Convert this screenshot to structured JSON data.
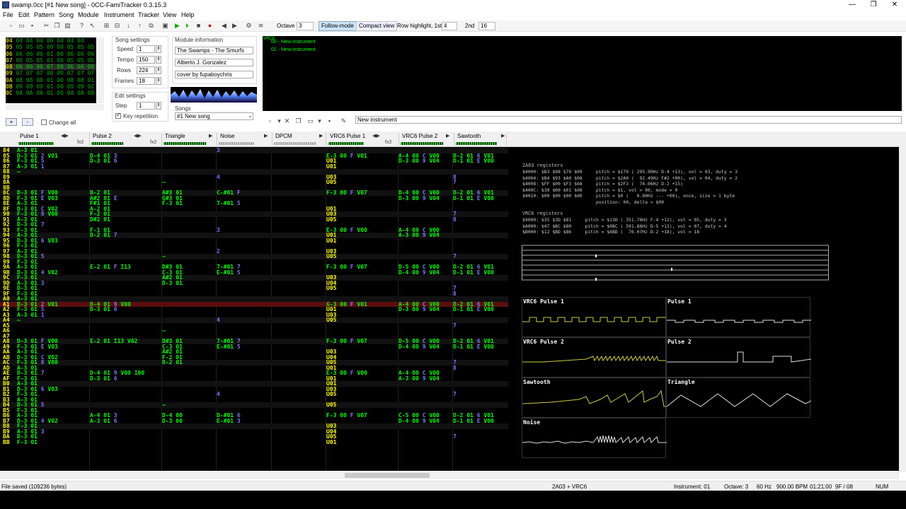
{
  "window": {
    "title": "swamp.0cc [#1 New song] - 0CC-FamiTracker 0.3.15.3",
    "min": "—",
    "max": "❐",
    "close": "✕"
  },
  "menu": [
    "File",
    "Edit",
    "Pattern",
    "Song",
    "Module",
    "Instrument",
    "Tracker",
    "View",
    "Help"
  ],
  "toolbar": {
    "octave_label": "Octave",
    "octave_value": "3",
    "follow_mode": "Follow-mode",
    "compact_view": "Compact view",
    "row_highlight_label": "Row highlight, 1st",
    "row_highlight_1st": "4",
    "second_label": "2nd",
    "row_highlight_2nd": "16"
  },
  "frames": {
    "rows": [
      {
        "n": "04",
        "cells": "04 04 04 00 04 04 04"
      },
      {
        "n": "05",
        "cells": "05 05 05 00 00 05 05 05"
      },
      {
        "n": "06",
        "cells": "06 06 06 01 00 06 06 06"
      },
      {
        "n": "07",
        "cells": "05 05 05 01 00 05 05 05"
      },
      {
        "n": "08",
        "cells": "06 06 06 07 00 06 06 06",
        "current": true
      },
      {
        "n": "09",
        "cells": "07 07 07 00 00 07 07 07"
      },
      {
        "n": "0A",
        "cells": "08 08 08 01 00 08 08 01"
      },
      {
        "n": "0B",
        "cells": "09 09 09 01 00 09 09 02"
      },
      {
        "n": "0C",
        "cells": "0A 0A 0A 01 00 0A 0A 09"
      }
    ],
    "add": "+",
    "remove": "-",
    "change_all": "Change all"
  },
  "song_settings": {
    "title": "Song settings",
    "speed_label": "Speed",
    "speed": "1",
    "tempo_label": "Tempo",
    "tempo": "150",
    "rows_label": "Rows",
    "rows": "224",
    "frames_label": "Frames",
    "frames": "18"
  },
  "edit_settings": {
    "title": "Edit settings",
    "step_label": "Step",
    "step": "1",
    "key_repetition": "Key repetition"
  },
  "module_info": {
    "title": "Module information",
    "name": "The Swamps - The Smurfs",
    "artist": "Alberto J. Gonzalez",
    "copyright": "cover by fupaboychris"
  },
  "songs": {
    "title": "Songs",
    "selected": "#1 New song"
  },
  "instruments": {
    "vrc6_tag": "VRC6",
    "items": [
      "00 - New instrument",
      "01 - New instrument"
    ],
    "name_field": "New instrument"
  },
  "channels": [
    {
      "name": "Pulse 1",
      "fx": "fx2"
    },
    {
      "name": "Pulse 2",
      "fx": "fx2"
    },
    {
      "name": "Triangle",
      "fx": ""
    },
    {
      "name": "Noise",
      "fx": ""
    },
    {
      "name": "DPCM",
      "fx": ""
    },
    {
      "name": "VRC6 Pulse 1",
      "fx": "fx2"
    },
    {
      "name": "VRC6 Pulse 2",
      "fx": ""
    },
    {
      "name": "Sawtooth",
      "fx": ""
    }
  ],
  "pattern_rows": [
    {
      "r": "84",
      "p1": "A-3 01",
      "p2": "",
      "tr": "",
      "no": "3",
      "v1": "",
      "v2": "",
      "sw": ""
    },
    {
      "r": "85",
      "p1": "D-3 01 2 V01",
      "p2": "D-4 01 3",
      "tr": "",
      "no": "",
      "v1": "E-3 00 F V01",
      "v2": "A-4 00 C V00",
      "sw": "D-2 01 6 V01"
    },
    {
      "r": "86",
      "p1": "F-3 01 5",
      "p2": "D-3 01 6",
      "tr": "",
      "no": "",
      "v1": "U01",
      "v2": "D-3 00 9 V04",
      "sw": "D-1 01 E V00"
    },
    {
      "r": "87",
      "p1": "A-3 01 1",
      "p2": "",
      "tr": "",
      "no": "",
      "v1": "U01",
      "v2": "",
      "sw": ""
    },
    {
      "r": "88",
      "p1": "—",
      "p2": "",
      "tr": "",
      "no": "",
      "v1": "",
      "v2": "",
      "sw": ""
    },
    {
      "r": "89",
      "p1": "",
      "p2": "",
      "tr": "",
      "no": "4",
      "v1": "U03",
      "v2": "",
      "sw": "8"
    },
    {
      "r": "8A",
      "p1": "",
      "p2": "",
      "tr": "—",
      "no": "",
      "v1": "U05",
      "v2": "",
      "sw": "7"
    },
    {
      "r": "8B",
      "p1": "",
      "p2": "",
      "tr": "",
      "no": "",
      "v1": "",
      "v2": "",
      "sw": ""
    },
    {
      "r": "8C",
      "p1": "D-3 01 F V00",
      "p2": "B-2 01",
      "tr": "A#3 01",
      "no": "C-#01 F",
      "v1": "F-3 00 F V07",
      "v2": "D-4 00 C V00",
      "sw": "D-2 01 6 V01"
    },
    {
      "r": "8D",
      "p1": "F-3 01 E V03",
      "p2": "A#2 01 E",
      "tr": "G#3 01",
      "no": "",
      "v1": "",
      "v2": "D-3 00 9 V04",
      "sw": "D-1 01 E V00"
    },
    {
      "r": "8E",
      "p1": "A-3 01",
      "p2": "F#1 01",
      "tr": "F-3 01",
      "no": "7-#01 5",
      "v1": "",
      "v2": "",
      "sw": ""
    },
    {
      "r": "8F",
      "p1": "D-3 01 C V02",
      "p2": "A-2 01",
      "tr": "",
      "no": "",
      "v1": "U01",
      "v2": "",
      "sw": ""
    },
    {
      "r": "90",
      "p1": "F-3 01 8 V00",
      "p2": "F-2 01",
      "tr": "",
      "no": "",
      "v1": "U03",
      "v2": "",
      "sw": "7"
    },
    {
      "r": "91",
      "p1": "A-3 01",
      "p2": "D#2 01",
      "tr": "",
      "no": "",
      "v1": "U05",
      "v2": "",
      "sw": "8"
    },
    {
      "r": "92",
      "p1": "D-3 01 7",
      "p2": "",
      "tr": "",
      "no": "",
      "v1": "",
      "v2": "",
      "sw": ""
    },
    {
      "r": "93",
      "p1": "F-3 01",
      "p2": "F-1 01",
      "tr": "",
      "no": "3",
      "v1": "E-3 00 F V00",
      "v2": "A-4 00 C V00",
      "sw": ""
    },
    {
      "r": "94",
      "p1": "A-3 01",
      "p2": "D-2 01 7",
      "tr": "",
      "no": "",
      "v1": "U01",
      "v2": "A-3 00 9 V04",
      "sw": ""
    },
    {
      "r": "95",
      "p1": "D-3 01 6 V03",
      "p2": "",
      "tr": "",
      "no": "",
      "v1": "U01",
      "v2": "",
      "sw": ""
    },
    {
      "r": "96",
      "p1": "F-3 01",
      "p2": "",
      "tr": "",
      "no": "",
      "v1": "",
      "v2": "",
      "sw": ""
    },
    {
      "r": "97",
      "p1": "A-3 01",
      "p2": "",
      "tr": "",
      "no": "2",
      "v1": "U03",
      "v2": "",
      "sw": ""
    },
    {
      "r": "98",
      "p1": "D-3 01 5",
      "p2": "",
      "tr": "—",
      "no": "",
      "v1": "U05",
      "v2": "",
      "sw": "7"
    },
    {
      "r": "99",
      "p1": "F-3 01",
      "p2": "",
      "tr": "",
      "no": "",
      "v1": "",
      "v2": "",
      "sw": ""
    },
    {
      "r": "9A",
      "p1": "A-3 01",
      "p2": "E-2 01 F I13",
      "tr": "D#3 01",
      "no": "7-#01 7",
      "v1": "F-3 00 F V07",
      "v2": "D-5 00 C V00",
      "sw": "D-2 01 6 V01"
    },
    {
      "r": "9B",
      "p1": "D-3 01 4 V02",
      "p2": "",
      "tr": "C-3 01",
      "no": "E-#01 5",
      "v1": "",
      "v2": "D-4 00 9 V04",
      "sw": "D-1 01 E V00"
    },
    {
      "r": "9C",
      "p1": "F-3 01",
      "p2": "",
      "tr": "A#2 01",
      "no": "",
      "v1": "U03",
      "v2": "",
      "sw": ""
    },
    {
      "r": "9D",
      "p1": "A-3 01 3",
      "p2": "",
      "tr": "D-3 01",
      "no": "",
      "v1": "U04",
      "v2": "",
      "sw": ""
    },
    {
      "r": "9E",
      "p1": "D-3 01",
      "p2": "",
      "tr": "",
      "no": "",
      "v1": "U05",
      "v2": "",
      "sw": "7"
    },
    {
      "r": "9F",
      "p1": "F-3 01",
      "p2": "",
      "tr": "",
      "no": "",
      "v1": "",
      "v2": "",
      "sw": "8"
    },
    {
      "r": "A0",
      "p1": "A-3 01",
      "p2": "",
      "tr": "",
      "no": "",
      "v1": "",
      "v2": "",
      "sw": ""
    },
    {
      "r": "A1",
      "p1": "D-3 01 2 V01",
      "p2": "D-4 01 9 V00",
      "tr": "",
      "no": "",
      "v1": "G-3 00 F V01",
      "v2": "A-4 00 C V00",
      "sw": "D-2 01 6 V01",
      "current": true
    },
    {
      "r": "A2",
      "p1": "F-3 01 5",
      "p2": "D-3 01 6",
      "tr": "",
      "no": "",
      "v1": "U01",
      "v2": "D-3 00 9 V04",
      "sw": "D-1 01 E V00"
    },
    {
      "r": "A3",
      "p1": "A-3 01 1",
      "p2": "",
      "tr": "",
      "no": "",
      "v1": "U03",
      "v2": "",
      "sw": ""
    },
    {
      "r": "A4",
      "p1": "—",
      "p2": "",
      "tr": "",
      "no": "4",
      "v1": "U05",
      "v2": "",
      "sw": ""
    },
    {
      "r": "A5",
      "p1": "",
      "p2": "",
      "tr": "",
      "no": "",
      "v1": "",
      "v2": "",
      "sw": "7"
    },
    {
      "r": "A6",
      "p1": "",
      "p2": "",
      "tr": "—",
      "no": "",
      "v1": "",
      "v2": "",
      "sw": ""
    },
    {
      "r": "A7",
      "p1": "",
      "p2": "",
      "tr": "",
      "no": "",
      "v1": "",
      "v2": "",
      "sw": ""
    },
    {
      "r": "A8",
      "p1": "D-3 01 F V00",
      "p2": "E-2 01 I13 V02",
      "tr": "D#3 01",
      "no": "7-#01 7",
      "v1": "F-3 00 F V07",
      "v2": "D-5 00 C V00",
      "sw": "D-2 01 6 V01"
    },
    {
      "r": "A9",
      "p1": "F-3 01 E V03",
      "p2": "",
      "tr": "C-3 01",
      "no": "E-#01 5",
      "v1": "",
      "v2": "D-4 00 9 V04",
      "sw": "D-1 01 E V00"
    },
    {
      "r": "AA",
      "p1": "A-3 01",
      "p2": "",
      "tr": "A#2 01",
      "no": "",
      "v1": "U03",
      "v2": "",
      "sw": ""
    },
    {
      "r": "AB",
      "p1": "D-3 01 C V02",
      "p2": "",
      "tr": "F-2 01",
      "no": "",
      "v1": "U04",
      "v2": "",
      "sw": ""
    },
    {
      "r": "AC",
      "p1": "F-3 01 8 V00",
      "p2": "",
      "tr": "D-2 01",
      "no": "",
      "v1": "U05",
      "v2": "",
      "sw": "7"
    },
    {
      "r": "AD",
      "p1": "A-3 01",
      "p2": "",
      "tr": "",
      "no": "",
      "v1": "U01",
      "v2": "",
      "sw": "8"
    },
    {
      "r": "AE",
      "p1": "D-3 01 7",
      "p2": "D-4 01 9 V00 I00",
      "tr": "",
      "no": "",
      "v1": "E-3 00 F V00",
      "v2": "A-4 00 C V00",
      "sw": ""
    },
    {
      "r": "AF",
      "p1": "F-3 01",
      "p2": "D-3 01 6",
      "tr": "",
      "no": "",
      "v1": "U01",
      "v2": "A-3 00 9 V04",
      "sw": ""
    },
    {
      "r": "B0",
      "p1": "A-3 01",
      "p2": "",
      "tr": "",
      "no": "",
      "v1": "U01",
      "v2": "",
      "sw": ""
    },
    {
      "r": "B1",
      "p1": "D-3 01 6 V03",
      "p2": "",
      "tr": "",
      "no": "",
      "v1": "U03",
      "v2": "",
      "sw": ""
    },
    {
      "r": "B2",
      "p1": "F-3 01",
      "p2": "",
      "tr": "",
      "no": "4",
      "v1": "U05",
      "v2": "",
      "sw": "7"
    },
    {
      "r": "B3",
      "p1": "A-3 01",
      "p2": "",
      "tr": "",
      "no": "",
      "v1": "",
      "v2": "",
      "sw": ""
    },
    {
      "r": "B4",
      "p1": "D-3 01 5",
      "p2": "",
      "tr": "—",
      "no": "",
      "v1": "U05",
      "v2": "",
      "sw": ""
    },
    {
      "r": "B5",
      "p1": "F-3 01",
      "p2": "",
      "tr": "",
      "no": "",
      "v1": "",
      "v2": "",
      "sw": ""
    },
    {
      "r": "B6",
      "p1": "A-3 01",
      "p2": "A-4 01 3",
      "tr": "D-4 00",
      "no": "D-#01 6",
      "v1": "F-3 00 F V07",
      "v2": "C-5 00 C V00",
      "sw": "D-2 01 6 V01"
    },
    {
      "r": "B7",
      "p1": "D-3 01 4 V02",
      "p2": "A-3 01 6",
      "tr": "D-3 00",
      "no": "E-#01 3",
      "v1": "",
      "v2": "D-4 00 9 V04",
      "sw": "D-1 01 E V00"
    },
    {
      "r": "B8",
      "p1": "F-3 01",
      "p2": "",
      "tr": "",
      "no": "",
      "v1": "U03",
      "v2": "",
      "sw": ""
    },
    {
      "r": "B9",
      "p1": "A-3 01 3",
      "p2": "",
      "tr": "",
      "no": "",
      "v1": "U04",
      "v2": "",
      "sw": ""
    },
    {
      "r": "BA",
      "p1": "D-3 01",
      "p2": "",
      "tr": "",
      "no": "",
      "v1": "U05",
      "v2": "",
      "sw": "7"
    },
    {
      "r": "BB",
      "p1": "F-3 01",
      "p2": "",
      "tr": "",
      "no": "",
      "v1": "U01",
      "v2": "",
      "sw": ""
    }
  ],
  "registers": {
    "title_2a03": "2A03 registers",
    "lines_2a03": [
      "$4000: $B3 $08 $79 $09     pitch = $179 ( 295.90Hz D-4 +13), vol = 03, duty = 3",
      "$4004: $B4 $93 $A0 $0A     pitch = $2A0 (  92.49Hz F#2 +00), vol = 04, duty = 2",
      "$4008: $FF $00 $F3 $0A     pitch = $2F3 (  74.06Hz D-2 +15)",
      "$400C: $30 $00 $01 $08     pitch = $1, vol = 00, mode = 0",
      "$4010: $00 $00 $00 $00     pitch = $0 (   0.00Hz --- +00), once, size = 1 byte",
      "                           position: 00, delta = $00"
    ],
    "title_vrc6": "VRC6 registers",
    "lines_vrc6": [
      "$9000: $35 $3D $81     pitch = $13D ( 351.76Hz F-4 +12), vol = 05, duty = 3",
      "$A000: $47 $BC $80     pitch = $0BC ( 591.86Hz D-5 +13), vol = 07, duty = 4",
      "$B000: $12 $BD $86     pitch = $6BD (  76.07Hz D-2 +18), vol = 18"
    ]
  },
  "scopes": [
    "VRC6 Pulse 1",
    "Pulse 1",
    "VRC6 Pulse 2",
    "Pulse 2",
    "Sawtooth",
    "Triangle",
    "Noise"
  ],
  "status": {
    "left": "File saved (109236 bytes)",
    "chip": "2A03 + VRC6",
    "instrument": "Instrument: 01",
    "octave": "Octave: 3",
    "rate": "60 Hz",
    "bpm": "900.00 BPM",
    "time": "01:21:00",
    "position": "9F / 08",
    "num": "NUM"
  }
}
